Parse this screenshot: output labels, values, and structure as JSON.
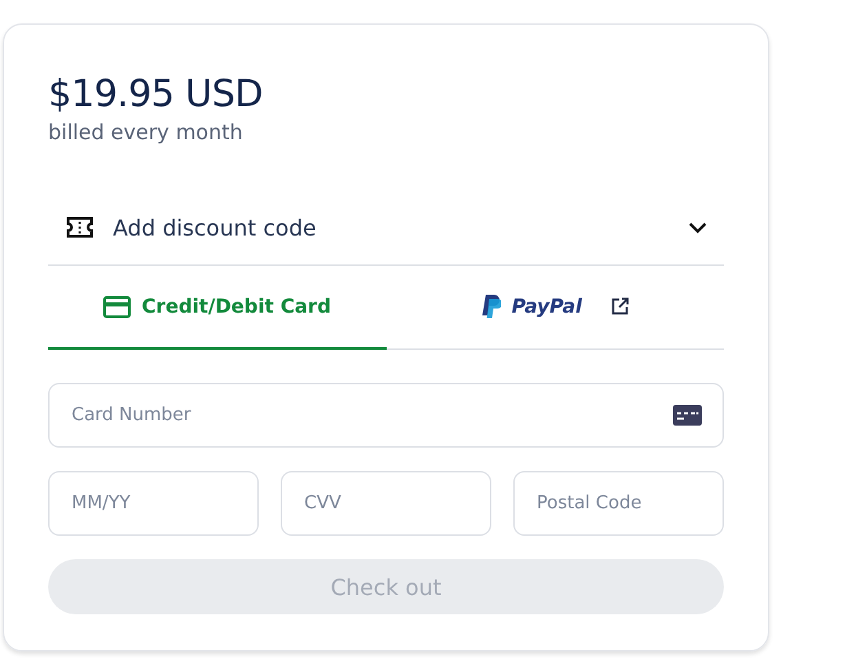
{
  "price": "$19.95 USD",
  "billing": "billed every month",
  "discount": {
    "label": "Add discount code",
    "expanded": false
  },
  "tabs": [
    {
      "kind": "card",
      "label": "Credit/Debit Card",
      "selected": true
    },
    {
      "kind": "paypal",
      "label": "PayPal",
      "selected": false
    }
  ],
  "fields": [
    {
      "kind": "card",
      "placeholder": "Card Number"
    },
    {
      "kind": "small",
      "placeholder": "MM/YY"
    },
    {
      "kind": "small",
      "placeholder": "CVV"
    },
    {
      "kind": "small",
      "placeholder": "Postal Code"
    }
  ],
  "checkout": {
    "label": "Check out",
    "disabled": true
  }
}
